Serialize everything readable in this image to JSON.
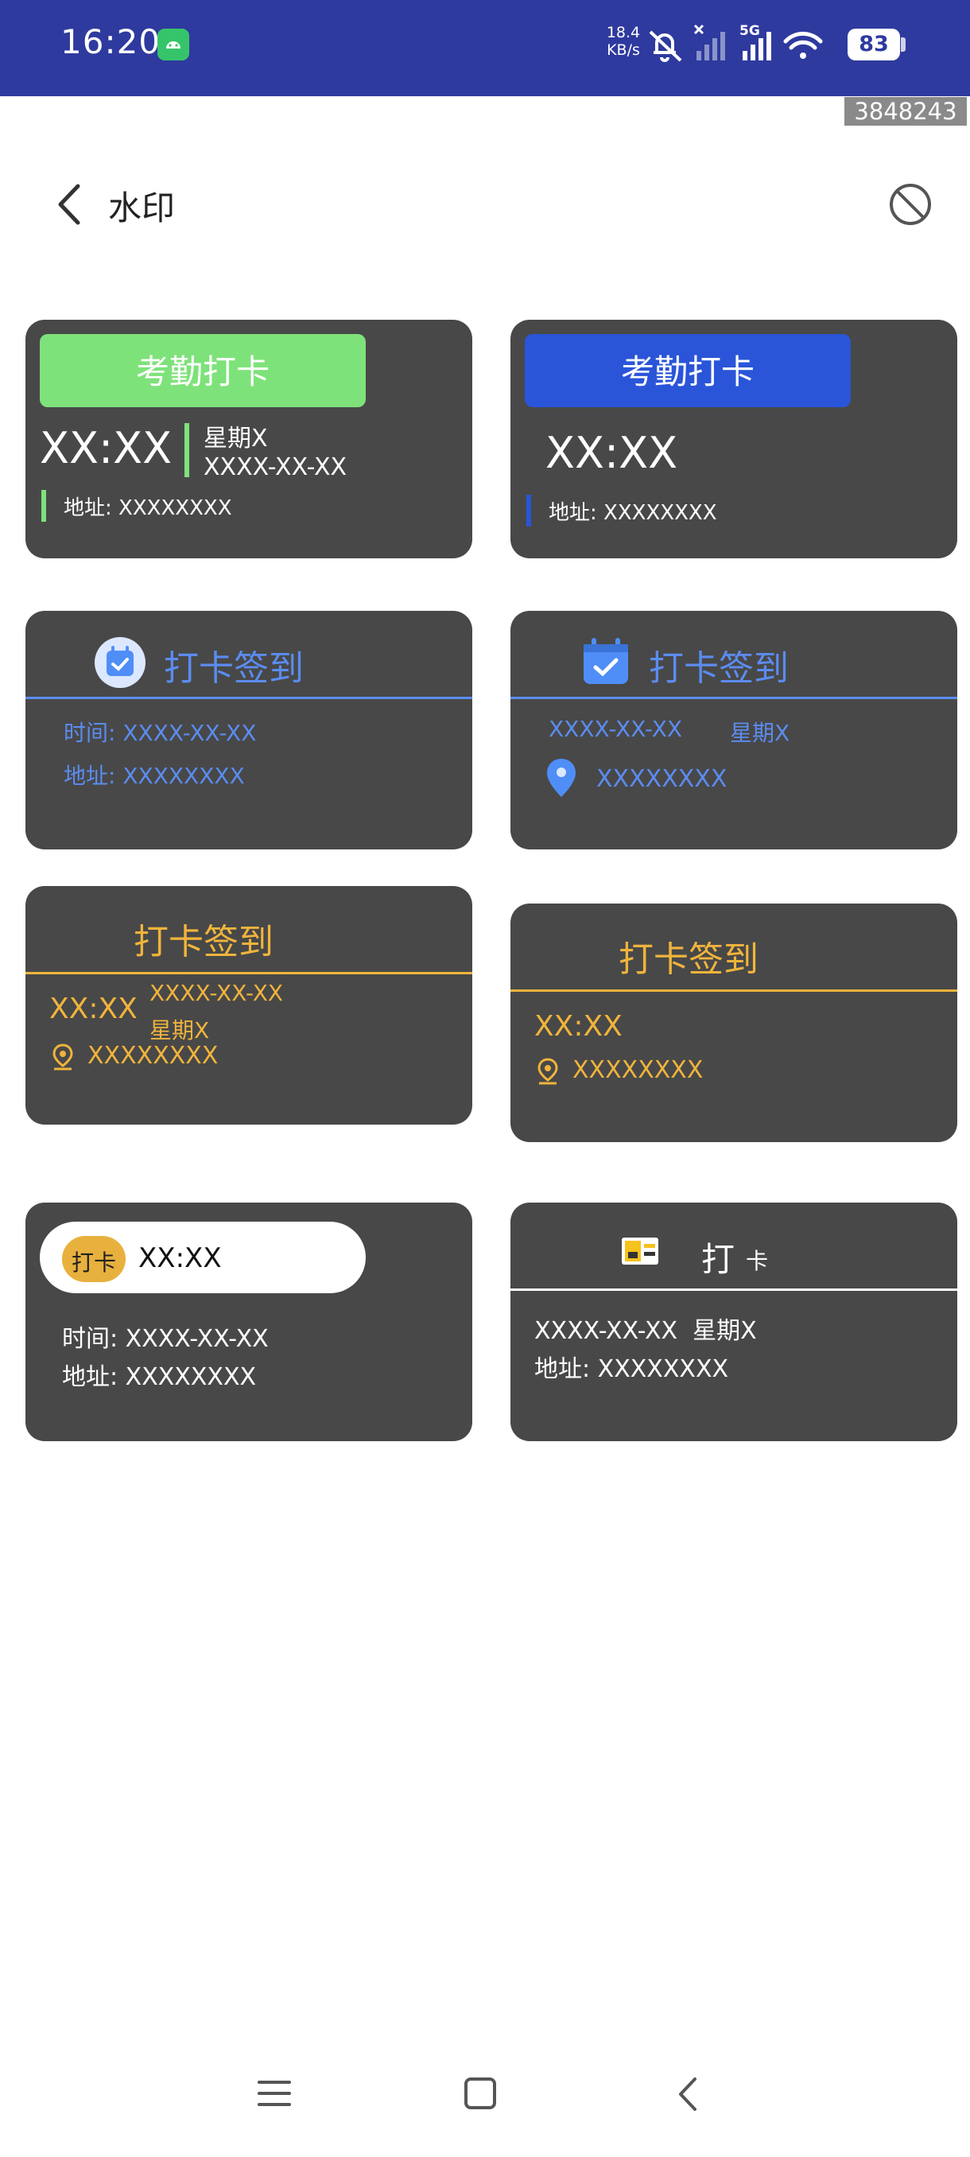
{
  "status_bar": {
    "time": "16:20",
    "net_speed_value": "18.4",
    "net_speed_unit": "KB/s",
    "network_label": "5G",
    "battery": "83"
  },
  "overlay_counter": "3848243",
  "header": {
    "title": "水印"
  },
  "cards": [
    {
      "title": "考勤打卡",
      "time": "XX:XX",
      "weekday": "星期X",
      "date": "XXXX-XX-XX",
      "address": "地址: XXXXXXXX",
      "accent": "#7ee27a"
    },
    {
      "title": "考勤打卡",
      "time": "XX:XX",
      "address": "地址: XXXXXXXX",
      "accent": "#2a55d8"
    },
    {
      "title": "打卡签到",
      "time_line": "时间: XXXX-XX-XX",
      "address_line": "地址: XXXXXXXX",
      "accent": "#5b8cf0"
    },
    {
      "title": "打卡签到",
      "date": "XXXX-XX-XX",
      "weekday": "星期X",
      "address": "XXXXXXXX",
      "accent": "#5b8cf0"
    },
    {
      "title": "打卡签到",
      "time": "XX:XX",
      "date": "XXXX-XX-XX",
      "weekday": "星期X",
      "address": "XXXXXXXX",
      "accent": "#f0b43c"
    },
    {
      "title": "打卡签到",
      "time": "XX:XX",
      "address": "XXXXXXXX",
      "accent": "#f0b43c"
    },
    {
      "badge": "打卡",
      "time": "XX:XX",
      "time_line": "时间: XXXX-XX-XX",
      "address_line": "地址: XXXXXXXX",
      "accent": "#e8b13e"
    },
    {
      "title_big": "打",
      "title_small": "卡",
      "date_weekday": "XXXX-XX-XX  星期X",
      "address_line": "地址: XXXXXXXX",
      "accent": "#ffffff"
    }
  ]
}
